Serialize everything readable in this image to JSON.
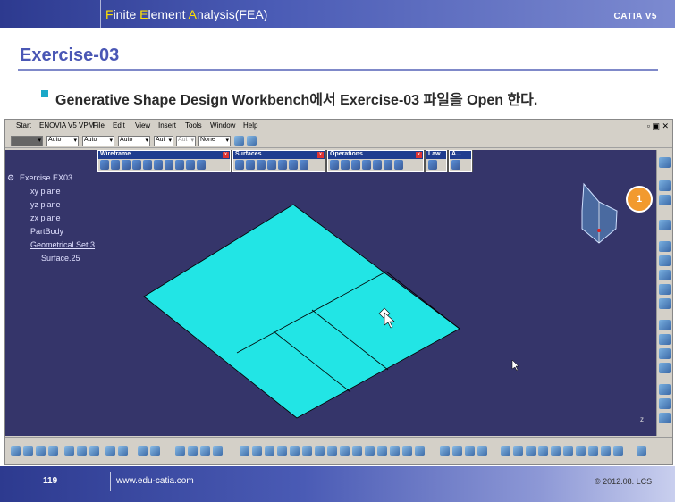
{
  "header": {
    "f": "F",
    "inite": "inite ",
    "e": "E",
    "lement": "lement ",
    "a": "A",
    "nalysis": "nalysis(FEA)",
    "brand": "CATIA V5"
  },
  "slide": {
    "title": "Exercise-03",
    "subtitle": "Generative Shape Design Workbench에서 Exercise-03 파일을 Open 한다."
  },
  "menu": [
    "Start",
    "ENOVIA V5 VPM",
    "File",
    "Edit",
    "View",
    "Insert",
    "Tools",
    "Window",
    "Help"
  ],
  "props": {
    "color": "",
    "s1": "Auto",
    "s2": "Auto",
    "s3": "Auto",
    "s4": "Aut",
    "s5": "Aut",
    "s6": "None"
  },
  "toolbars": {
    "wireframe": "Wireframe",
    "surfaces": "Surfaces",
    "operations": "Operations",
    "law": "Law",
    "analysis": "A..."
  },
  "tree": {
    "root": "Exercise EX03",
    "xy": "xy plane",
    "yz": "yz plane",
    "zx": "zx plane",
    "partbody": "PartBody",
    "geoset": "Geometrical Set.3",
    "surface": "Surface.25"
  },
  "badge": "1",
  "footer": {
    "page": "119",
    "url": "www.edu-catia.com",
    "copyright": "© 2012.08. LCS"
  },
  "colors": {
    "surface": "#22e5e5",
    "viewport": "#35356a",
    "badge": "#f29a2e"
  }
}
